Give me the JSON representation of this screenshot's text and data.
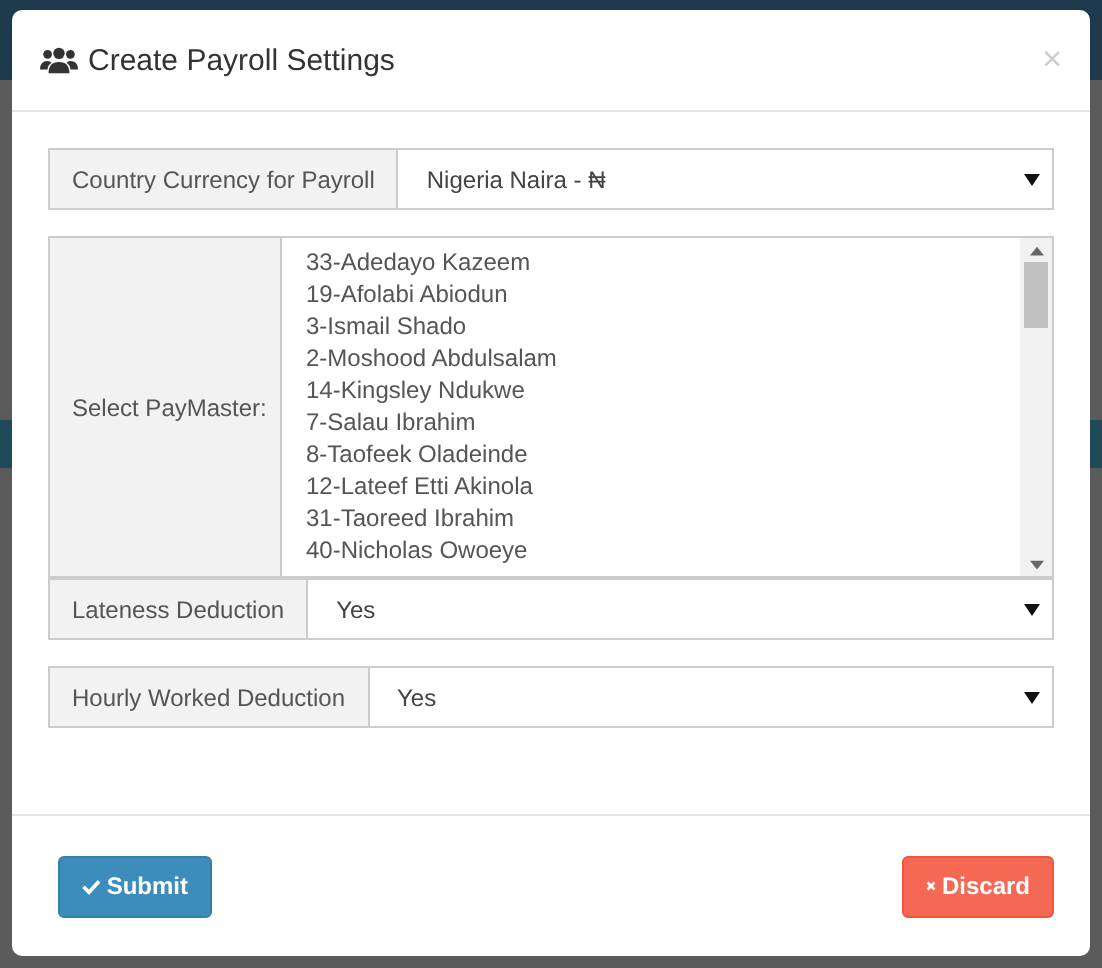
{
  "modal": {
    "title": "Create Payroll Settings",
    "close": "×"
  },
  "fields": [
    {
      "kind": "select",
      "label": "Country Currency for Payroll",
      "value": "Nigeria Naira - ₦"
    },
    {
      "kind": "list",
      "label": "Select PayMaster:",
      "options": [
        {
          "text": "33-Adedayo Kazeem",
          "selected": false
        },
        {
          "text": "19-Afolabi Abiodun",
          "selected": false
        },
        {
          "text": "3-Ismail Shado",
          "selected": false
        },
        {
          "text": "2-Moshood Abdulsalam",
          "selected": false
        },
        {
          "text": "14-Kingsley Ndukwe",
          "selected": false
        },
        {
          "text": "7-Salau Ibrahim",
          "selected": false
        },
        {
          "text": "8-Taofeek Oladeinde",
          "selected": false
        },
        {
          "text": "12-Lateef Etti Akinola",
          "selected": false
        },
        {
          "text": "31-Taoreed Ibrahim",
          "selected": false
        },
        {
          "text": "40-Nicholas Owoeye",
          "selected": false
        }
      ]
    },
    {
      "kind": "select",
      "label": "Lateness Deduction",
      "value": "Yes"
    },
    {
      "kind": "select",
      "label": "Hourly Worked Deduction",
      "value": "Yes"
    }
  ],
  "buttons": [
    {
      "kind": "submit",
      "label": "Submit"
    },
    {
      "kind": "discard",
      "label": "Discard"
    }
  ]
}
